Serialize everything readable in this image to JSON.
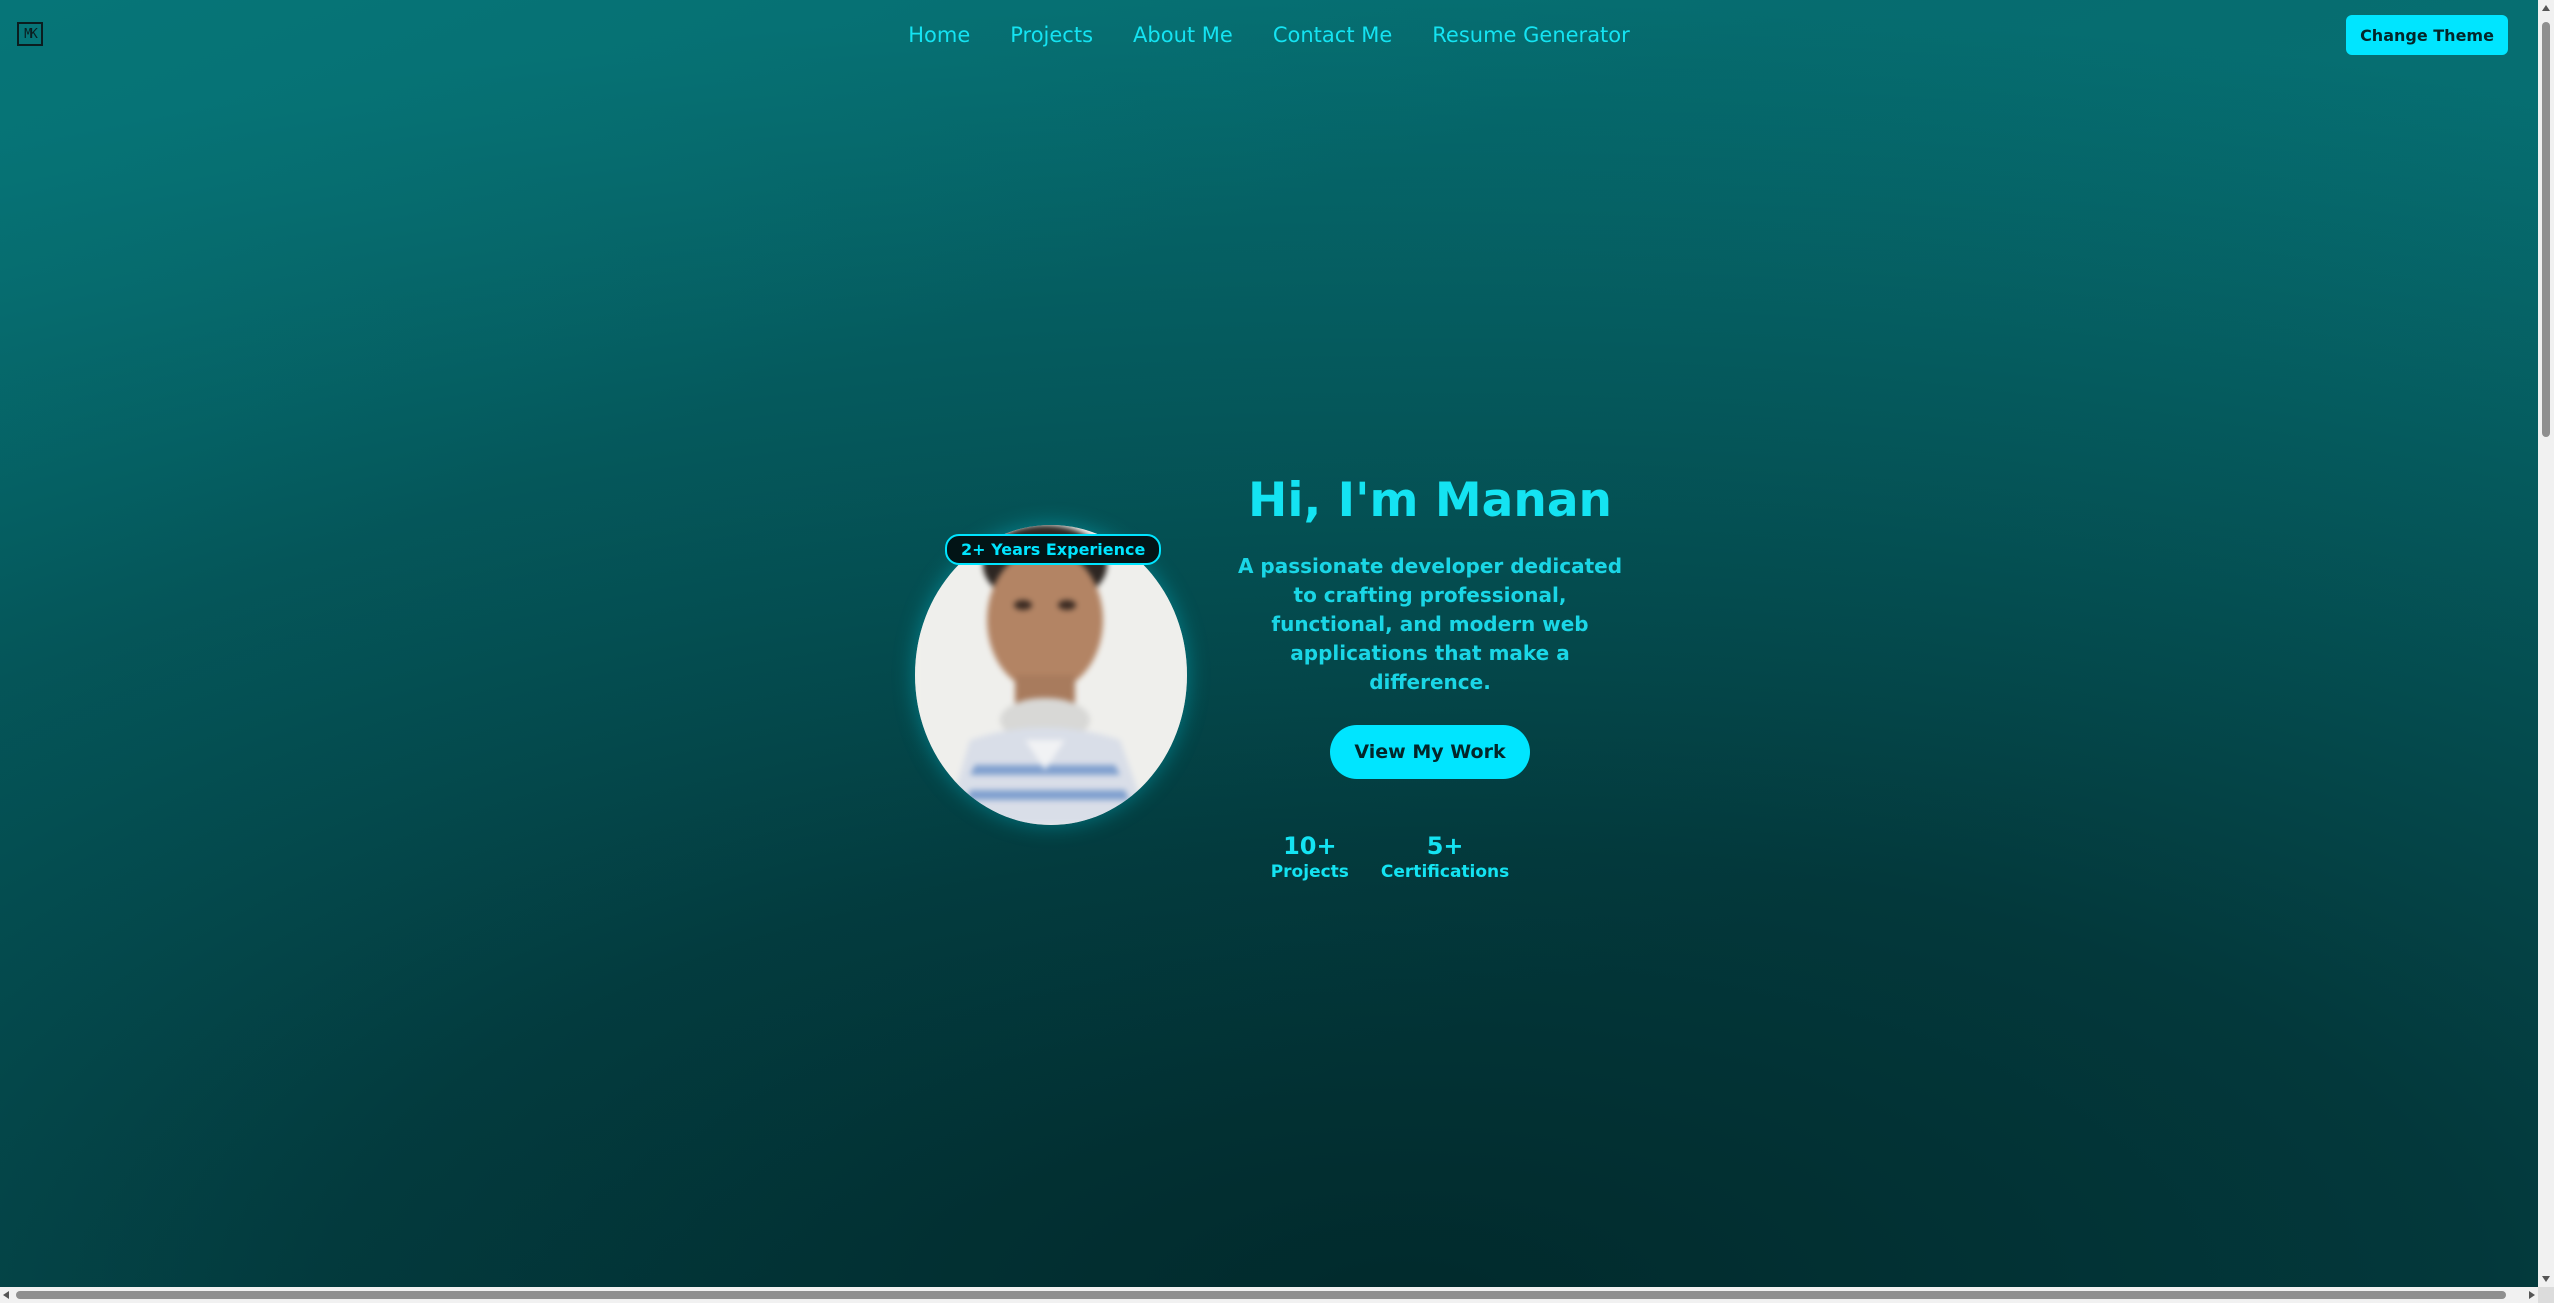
{
  "header": {
    "logo_text": "MK",
    "nav": [
      {
        "label": "Home"
      },
      {
        "label": "Projects"
      },
      {
        "label": "About Me"
      },
      {
        "label": "Contact Me"
      },
      {
        "label": "Resume Generator"
      }
    ],
    "theme_button": "Change Theme"
  },
  "hero": {
    "badge": "2+ Years Experience",
    "title": "Hi, I'm Manan",
    "tagline": "A passionate developer dedicated to crafting professional, functional, and modern web applications that make a difference.",
    "cta": "View My Work",
    "stats": [
      {
        "value": "10+",
        "label": "Projects"
      },
      {
        "value": "5+",
        "label": "Certifications"
      }
    ]
  },
  "colors": {
    "accent": "#00e5ff",
    "background_top": "#067275",
    "background_bottom": "#012a2c"
  }
}
